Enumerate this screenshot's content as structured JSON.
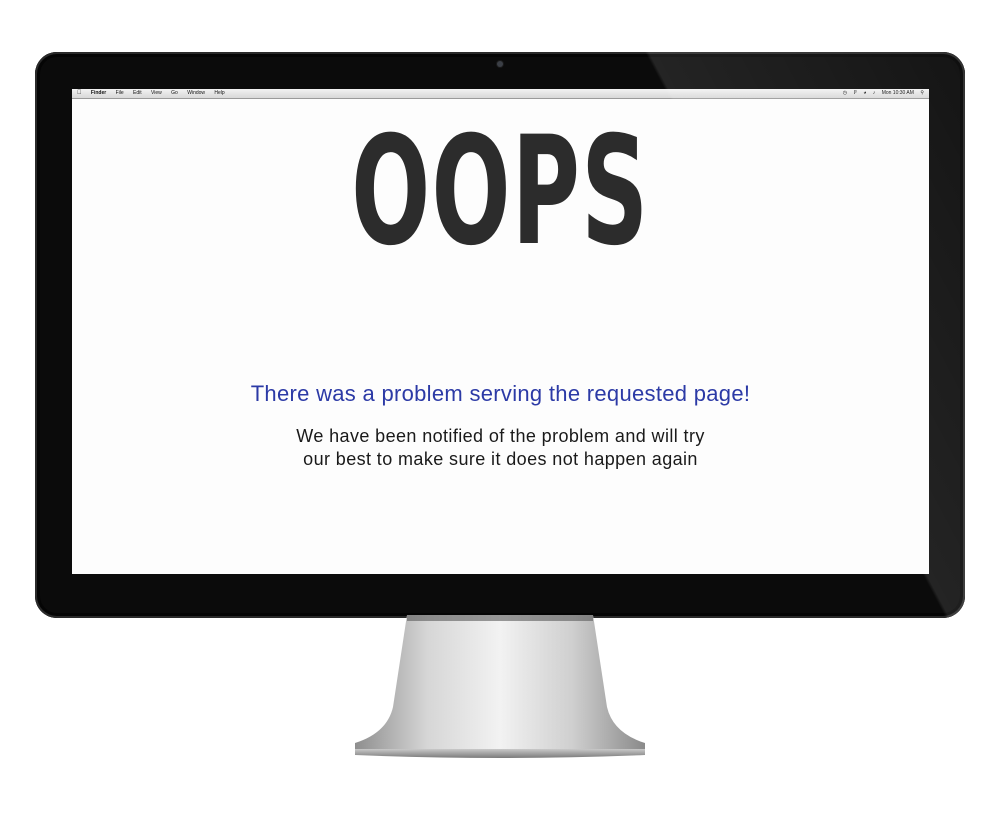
{
  "menubar": {
    "apple_icon": "apple-logo-icon",
    "items": [
      "Finder",
      "File",
      "Edit",
      "View",
      "Go",
      "Window",
      "Help"
    ],
    "clock": "Mon 10:30 AM",
    "status_icons": [
      "time-machine-icon",
      "bluetooth-icon",
      "wifi-icon",
      "volume-icon",
      "spotlight-icon"
    ]
  },
  "error": {
    "heading": "OOPS",
    "headline": "There was a problem serving the requested page!",
    "message_line1": "We have been notified of the problem and will try",
    "message_line2": "our best to make sure it does not happen again"
  },
  "colors": {
    "headline": "#2c3aa6",
    "heading": "#2c2c2c",
    "bezel": "#0b0b0b",
    "screen": "#fdfdfd"
  }
}
